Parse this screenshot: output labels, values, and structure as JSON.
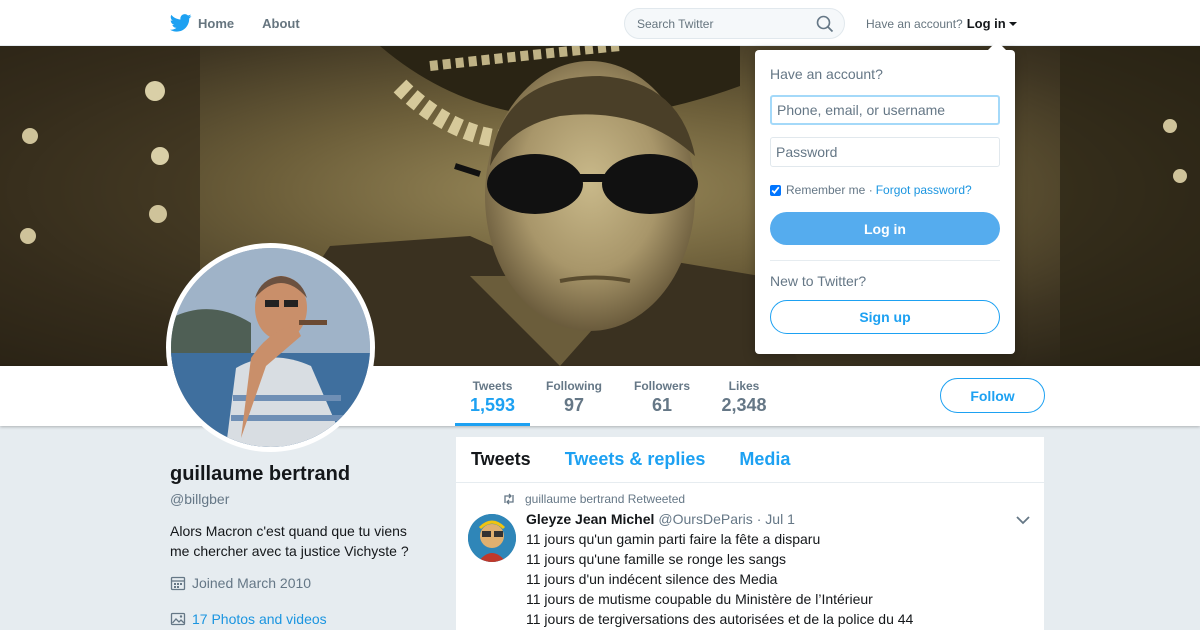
{
  "nav": {
    "home_label": "Home",
    "about_label": "About",
    "search_placeholder": "Search Twitter",
    "have_account": "Have an account?",
    "login_label": "Log in"
  },
  "profile": {
    "name": "guillaume bertrand",
    "handle": "@billgber",
    "bio": "Alors Macron c'est quand que tu viens me chercher avec ta justice Vichyste ?",
    "joined": "Joined March 2010",
    "photos": "17 Photos and videos"
  },
  "stats": [
    {
      "label": "Tweets",
      "value": "1,593"
    },
    {
      "label": "Following",
      "value": "97"
    },
    {
      "label": "Followers",
      "value": "61"
    },
    {
      "label": "Likes",
      "value": "2,348"
    }
  ],
  "follow_label": "Follow",
  "timeline": {
    "tabs": [
      "Tweets",
      "Tweets & replies",
      "Media"
    ],
    "retweet_context": "guillaume bertrand Retweeted",
    "tweet": {
      "author": "Gleyze Jean Michel",
      "handle": "@OursDeParis",
      "date": "· Jul 1",
      "lines": [
        "11 jours qu'un gamin parti faire la fête a disparu",
        "11 jours qu'une famille se ronge les sangs",
        "11 jours d'un indécent silence des Media",
        "11 jours de mutisme coupable du Ministère de l’Intérieur",
        "11 jours de tergiversations des autorisées et de la police du 44"
      ]
    }
  },
  "login_dropdown": {
    "title": "Have an account?",
    "username_placeholder": "Phone, email, or username",
    "password_placeholder": "Password",
    "remember_label": "Remember me ·",
    "forgot_label": "Forgot password?",
    "login_button": "Log in",
    "new_label": "New to Twitter?",
    "signup_button": "Sign up"
  },
  "colors": {
    "accent": "#1da1f2",
    "login_button": "#55acee"
  },
  "icons": [
    "twitter-bird-icon",
    "home-icon",
    "search-icon",
    "calendar-icon",
    "photo-icon",
    "retweet-icon",
    "chevron-down-icon"
  ]
}
